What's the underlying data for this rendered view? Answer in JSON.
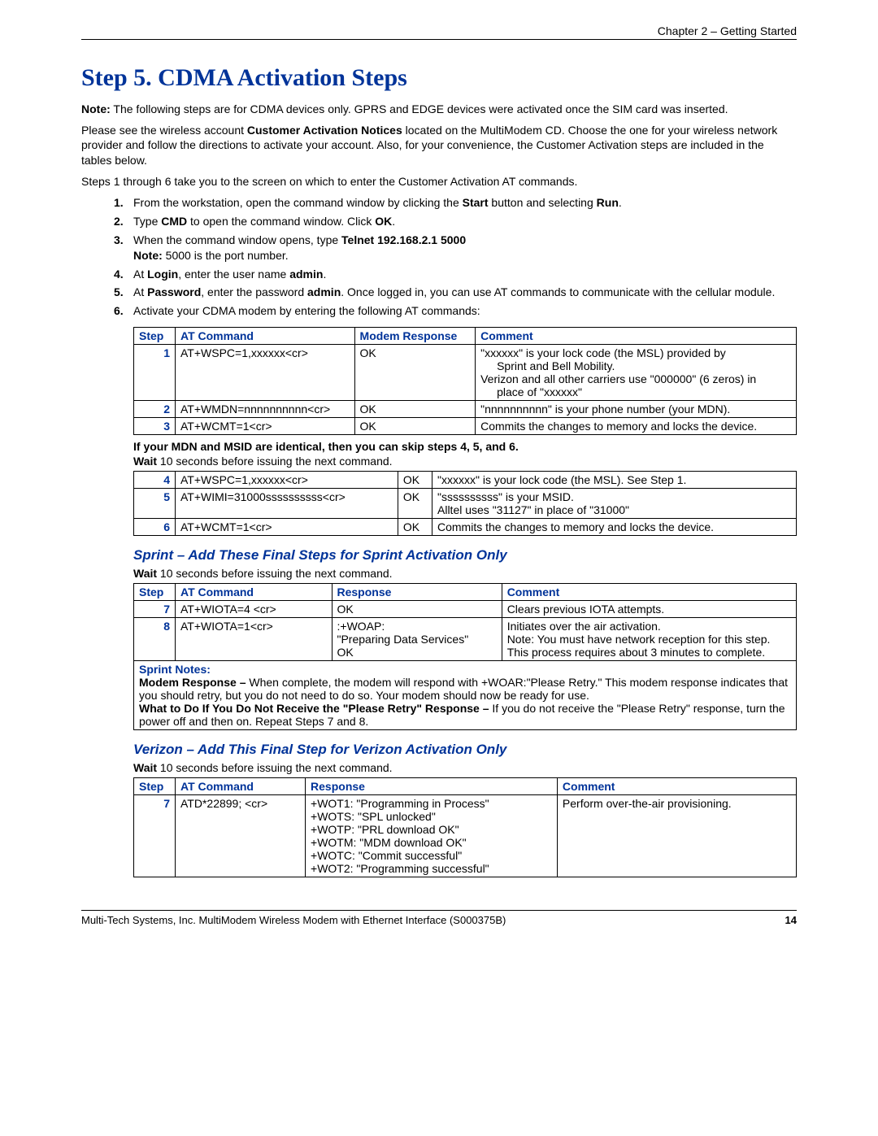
{
  "header": {
    "chapter": "Chapter 2 – Getting Started"
  },
  "title": "Step 5.  CDMA Activation Steps",
  "note_prefix": "Note:",
  "note_text": " The following steps are for CDMA devices only. GPRS and EDGE devices were activated once the SIM card was inserted.",
  "para_customer_notices_1": "Please see the wireless account ",
  "para_customer_notices_bold": "Customer Activation Notices",
  "para_customer_notices_2": " located on the MultiModem CD. Choose the one for your wireless network provider and follow the directions to activate your account. Also, for your convenience, the Customer Activation steps are included in the tables below.",
  "para_steps_intro": "Steps 1 through 6 take you to the screen on which to enter the Customer Activation AT commands.",
  "steps": {
    "s1_a": "From the workstation, open the command window by clicking the ",
    "s1_b": "Start",
    "s1_c": " button and selecting ",
    "s1_d": "Run",
    "s1_e": ".",
    "s2_a": "Type ",
    "s2_b": "CMD",
    "s2_c": " to open the command window. Click ",
    "s2_d": "OK",
    "s2_e": ".",
    "s3_a": "When the command window opens, type ",
    "s3_b": "Telnet 192.168.2.1 5000",
    "s3_note_b": "Note:",
    "s3_note_t": " 5000 is the port number.",
    "s4_a": "At ",
    "s4_b": "Login",
    "s4_c": ", enter the user name ",
    "s4_d": "admin",
    "s4_e": ".",
    "s5_a": "At ",
    "s5_b": "Password",
    "s5_c": ", enter the password ",
    "s5_d": "admin",
    "s5_e": ". Once logged in, you can use AT commands to communicate with the cellular module.",
    "s6": "Activate your CDMA modem by entering the following AT commands:"
  },
  "table1": {
    "h1": "Step",
    "h2": "AT Command",
    "h3": "Modem Response",
    "h4": "Comment",
    "r1": {
      "n": "1",
      "cmd": "AT+WSPC=1,xxxxxx<cr>",
      "resp": "OK",
      "c_l1": "\"xxxxxx\" is your lock code (the MSL) provided by",
      "c_l1b": "Sprint and Bell Mobility.",
      "c_l2": "Verizon and all other carriers use \"000000\" (6 zeros) in",
      "c_l2b": "place of \"xxxxxx\""
    },
    "r2": {
      "n": "2",
      "cmd": "AT+WMDN=nnnnnnnnnn<cr>",
      "resp": "OK",
      "c": "\"nnnnnnnnnn\" is your phone number (your MDN)."
    },
    "r3": {
      "n": "3",
      "cmd": "AT+WCMT=1<cr>",
      "resp": "OK",
      "c": "Commits the changes to memory and locks the device."
    }
  },
  "mid_bold": "If your MDN and MSID are identical, then you can skip steps 4, 5, and 6.",
  "wait_prefix": "Wait",
  "wait_text": " 10 seconds before issuing the next command.",
  "table2": {
    "r4": {
      "n": "4",
      "cmd": "AT+WSPC=1,xxxxxx<cr>",
      "resp": "OK",
      "c": "\"xxxxxx\" is your lock code (the MSL). See Step 1."
    },
    "r5": {
      "n": "5",
      "cmd": "AT+WIMI=31000ssssssssss<cr>",
      "resp": "OK",
      "c_l1": "\"ssssssssss\" is your MSID.",
      "c_l2": "Alltel uses \"31127\" in place of \"31000\""
    },
    "r6": {
      "n": "6",
      "cmd": "AT+WCMT=1<cr>",
      "resp": "OK",
      "c": "Commits the changes to memory and locks the device."
    }
  },
  "sprint": {
    "heading": "Sprint – Add These Final Steps for Sprint Activation Only",
    "table": {
      "h1": "Step",
      "h2": "AT Command",
      "h3": "Response",
      "h4": "Comment",
      "r7": {
        "n": "7",
        "cmd": "AT+WIOTA=4 <cr>",
        "resp": "OK",
        "c": "Clears previous IOTA attempts."
      },
      "r8": {
        "n": "8",
        "cmd": "AT+WIOTA=1<cr>",
        "resp_l1": ":+WOAP:",
        "resp_l2": "\"Preparing Data Services\"",
        "resp_l3": "OK",
        "c_l1": "Initiates over the air activation.",
        "c_l2": "Note: You must have network reception for this step.",
        "c_l3": "This process requires about 3 minutes to complete."
      }
    },
    "notes_label": "Sprint Notes:",
    "notes_l1_b": "Modem Response – ",
    "notes_l1": "When complete, the modem will respond with +WOAR:\"Please Retry.\" This modem response indicates that you should retry, but you do not need to do so. Your modem should now be ready for use.",
    "notes_l2_b": "What to Do If You Do Not Receive the \"Please Retry\" Response – ",
    "notes_l2": "If you do not receive the \"Please Retry\" response, turn the power off and then on. Repeat Steps 7 and 8."
  },
  "verizon": {
    "heading": "Verizon – Add This Final Step for Verizon Activation Only",
    "table": {
      "h1": "Step",
      "h2": "AT Command",
      "h3": "Response",
      "h4": "Comment",
      "r7": {
        "n": "7",
        "cmd": "ATD*22899; <cr>",
        "resp_l1": "+WOT1: \"Programming in Process\"",
        "resp_l2": "+WOTS: \"SPL unlocked\"",
        "resp_l3": "+WOTP: \"PRL download OK\"",
        "resp_l4": "+WOTM: \"MDM download OK\"",
        "resp_l5": "+WOTC: \"Commit successful\"",
        "resp_l6": "+WOT2: \"Programming successful\"",
        "c": "Perform over-the-air provisioning."
      }
    }
  },
  "footer": {
    "left": "Multi-Tech Systems, Inc. MultiModem Wireless Modem with Ethernet Interface (S000375B)",
    "right": "14"
  }
}
